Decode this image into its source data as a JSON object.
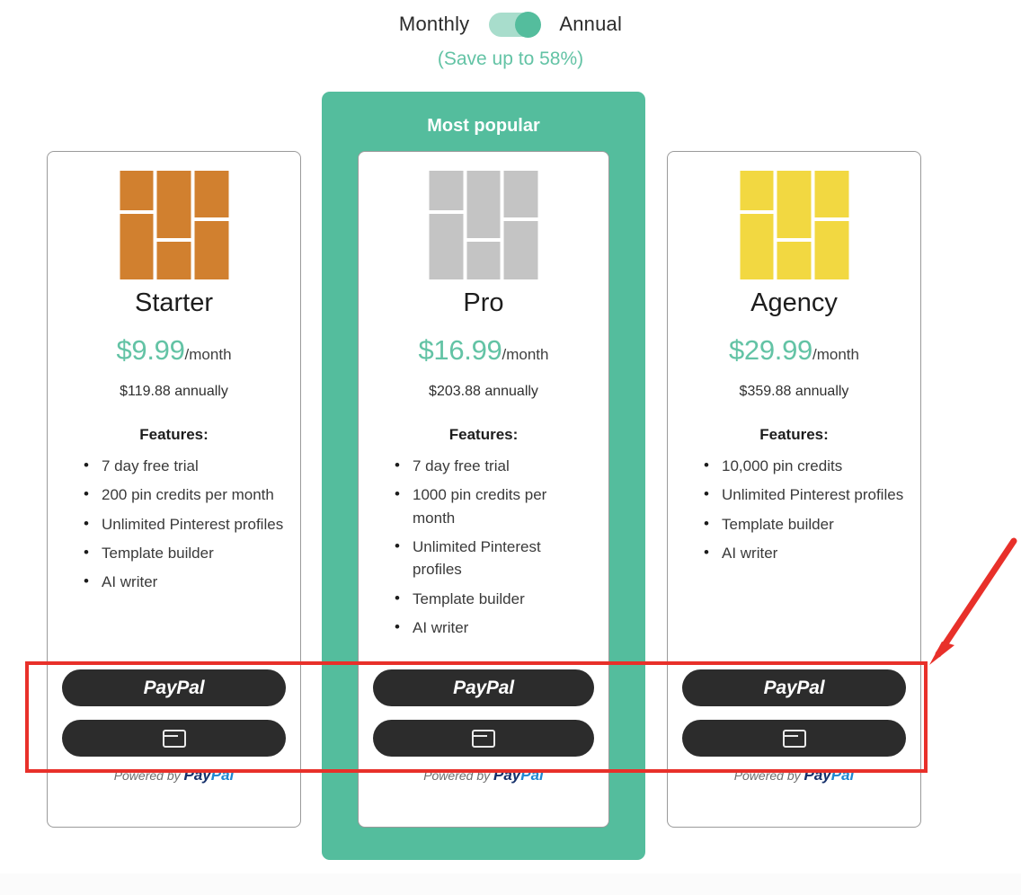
{
  "billing": {
    "monthly_label": "Monthly",
    "annual_label": "Annual",
    "toggle_state": "annual",
    "save_note": "(Save up to 58%)"
  },
  "popular": {
    "badge": "Most popular",
    "highlight_color": "#54bd9d"
  },
  "accent_color": "#63c3a5",
  "annotation": {
    "color": "#e8302a",
    "shape": "rectangle-with-arrow"
  },
  "payment": {
    "paypal_label": "PayPal",
    "card_icon": "credit-card-icon",
    "powered_prefix": "Powered by ",
    "powered_pay": "Pay",
    "powered_pal": "Pal"
  },
  "features_heading": "Features:",
  "plans": [
    {
      "id": "starter",
      "name": "Starter",
      "icon": "mosaic-grid-icon",
      "icon_color": "#d1802f",
      "price": "$9.99",
      "period": "/month",
      "annual": "$119.88 annually",
      "features": [
        "7 day free trial",
        "200 pin credits per month",
        "Unlimited Pinterest profiles",
        "Template builder",
        "AI writer"
      ]
    },
    {
      "id": "pro",
      "name": "Pro",
      "icon": "mosaic-grid-icon",
      "icon_color": "#c4c4c4",
      "price": "$16.99",
      "period": "/month",
      "annual": "$203.88 annually",
      "features": [
        "7 day free trial",
        "1000 pin credits per month",
        "Unlimited Pinterest profiles",
        "Template builder",
        "AI writer"
      ]
    },
    {
      "id": "agency",
      "name": "Agency",
      "icon": "mosaic-grid-icon",
      "icon_color": "#f2d841",
      "price": "$29.99",
      "period": "/month",
      "annual": "$359.88 annually",
      "features": [
        "10,000 pin credits",
        "Unlimited Pinterest profiles",
        "Template builder",
        "AI writer"
      ]
    }
  ]
}
